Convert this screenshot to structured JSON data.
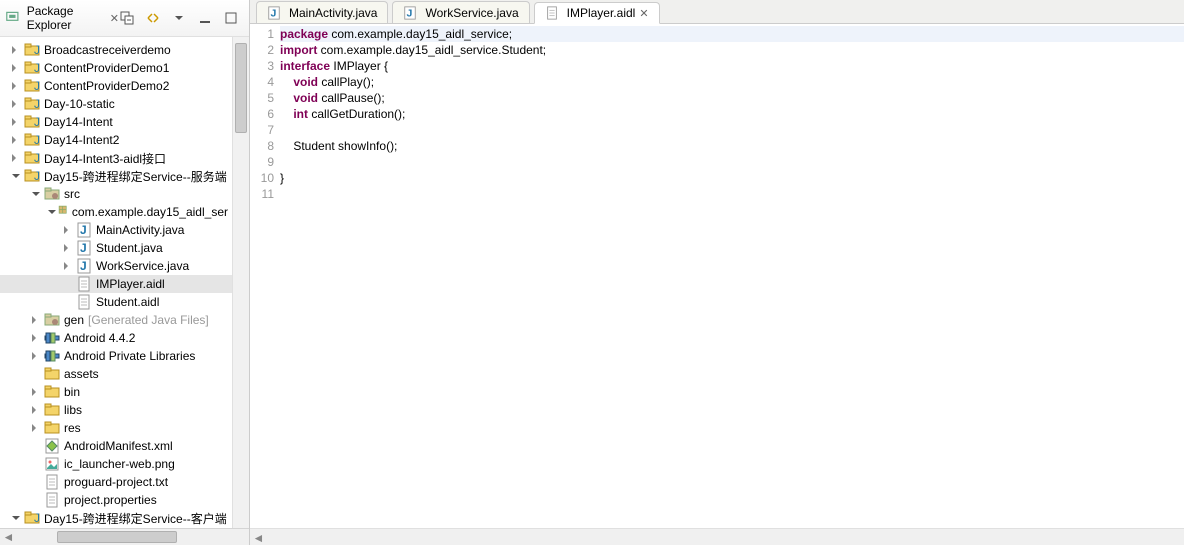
{
  "sidebar": {
    "title": "Package Explorer",
    "items": [
      {
        "label": "Broadcastreceiverdemo",
        "icon": "project",
        "indent": 10,
        "arrow": "collapsed"
      },
      {
        "label": "ContentProviderDemo1",
        "icon": "project",
        "indent": 10,
        "arrow": "collapsed"
      },
      {
        "label": "ContentProviderDemo2",
        "icon": "project",
        "indent": 10,
        "arrow": "collapsed"
      },
      {
        "label": "Day-10-static",
        "icon": "project",
        "indent": 10,
        "arrow": "collapsed"
      },
      {
        "label": "Day14-Intent",
        "icon": "project",
        "indent": 10,
        "arrow": "collapsed"
      },
      {
        "label": "Day14-Intent2",
        "icon": "project",
        "indent": 10,
        "arrow": "collapsed"
      },
      {
        "label": "Day14-Intent3-aidl接口",
        "icon": "project",
        "indent": 10,
        "arrow": "collapsed"
      },
      {
        "label": "Day15-跨进程绑定Service--服务端",
        "icon": "project",
        "indent": 10,
        "arrow": "expanded"
      },
      {
        "label": "src",
        "icon": "srcfolder",
        "indent": 30,
        "arrow": "expanded"
      },
      {
        "label": "com.example.day15_aidl_ser",
        "icon": "package",
        "indent": 46,
        "arrow": "expanded"
      },
      {
        "label": "MainActivity.java",
        "icon": "java",
        "indent": 62,
        "arrow": "collapsed"
      },
      {
        "label": "Student.java",
        "icon": "java",
        "indent": 62,
        "arrow": "collapsed"
      },
      {
        "label": "WorkService.java",
        "icon": "java",
        "indent": 62,
        "arrow": "collapsed"
      },
      {
        "label": "IMPlayer.aidl",
        "icon": "file",
        "indent": 62,
        "arrow": "none",
        "selected": true
      },
      {
        "label": "Student.aidl",
        "icon": "file",
        "indent": 62,
        "arrow": "none"
      },
      {
        "label": "gen",
        "icon": "genfolder",
        "indent": 30,
        "arrow": "collapsed",
        "decoration": "[Generated Java Files]"
      },
      {
        "label": "Android 4.4.2",
        "icon": "lib",
        "indent": 30,
        "arrow": "collapsed"
      },
      {
        "label": "Android Private Libraries",
        "icon": "lib",
        "indent": 30,
        "arrow": "collapsed"
      },
      {
        "label": "assets",
        "icon": "folder",
        "indent": 30,
        "arrow": "none"
      },
      {
        "label": "bin",
        "icon": "folder",
        "indent": 30,
        "arrow": "collapsed"
      },
      {
        "label": "libs",
        "icon": "folder",
        "indent": 30,
        "arrow": "collapsed"
      },
      {
        "label": "res",
        "icon": "folder",
        "indent": 30,
        "arrow": "collapsed"
      },
      {
        "label": "AndroidManifest.xml",
        "icon": "xml",
        "indent": 30,
        "arrow": "none"
      },
      {
        "label": "ic_launcher-web.png",
        "icon": "image",
        "indent": 30,
        "arrow": "none"
      },
      {
        "label": "proguard-project.txt",
        "icon": "file",
        "indent": 30,
        "arrow": "none"
      },
      {
        "label": "project.properties",
        "icon": "file",
        "indent": 30,
        "arrow": "none"
      },
      {
        "label": "Day15-跨进程绑定Service--客户端",
        "icon": "project",
        "indent": 10,
        "arrow": "expanded"
      }
    ]
  },
  "tabs": [
    {
      "label": "MainActivity.java",
      "icon": "java",
      "active": false
    },
    {
      "label": "WorkService.java",
      "icon": "java",
      "active": false
    },
    {
      "label": "IMPlayer.aidl",
      "icon": "file",
      "active": true
    }
  ],
  "code": {
    "lines": [
      {
        "n": 1,
        "t": "package com.example.day15_aidl_service;",
        "hl": true,
        "kw": "package"
      },
      {
        "n": 2,
        "t": "import com.example.day15_aidl_service.Student;",
        "kw": "import"
      },
      {
        "n": 3,
        "t": "interface IMPlayer {",
        "kw": "interface"
      },
      {
        "n": 4,
        "t": "    void callPlay();",
        "kw": "void"
      },
      {
        "n": 5,
        "t": "    void callPause();",
        "kw": "void"
      },
      {
        "n": 6,
        "t": "    int callGetDuration();",
        "kw": "int"
      },
      {
        "n": 7,
        "t": ""
      },
      {
        "n": 8,
        "t": "    Student showInfo();"
      },
      {
        "n": 9,
        "t": ""
      },
      {
        "n": 10,
        "t": "}"
      },
      {
        "n": 11,
        "t": ""
      }
    ]
  }
}
